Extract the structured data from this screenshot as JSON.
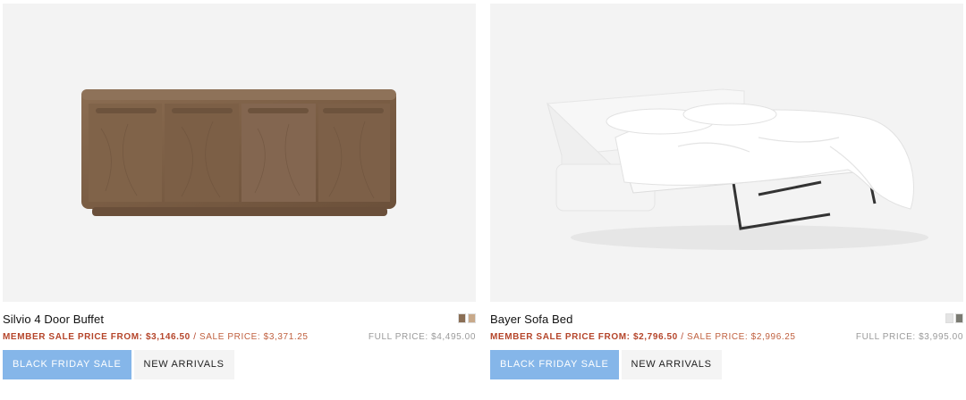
{
  "products": [
    {
      "name": "Silvio 4 Door Buffet",
      "member_price": "MEMBER SALE PRICE FROM: $3,146.50",
      "separator": "/",
      "sale_price": "SALE PRICE: $3,371.25",
      "full_price": "FULL PRICE: $4,495.00",
      "swatches": [
        "#8a6e55",
        "#c8a98a"
      ],
      "tags": [
        "BLACK FRIDAY SALE",
        "NEW ARRIVALS"
      ]
    },
    {
      "name": "Bayer Sofa Bed",
      "member_price": "MEMBER SALE PRICE FROM: $2,796.50",
      "separator": "/",
      "sale_price": "SALE PRICE: $2,996.25",
      "full_price": "FULL PRICE: $3,995.00",
      "swatches": [
        "#e4e4e4",
        "#7a7a72"
      ],
      "tags": [
        "BLACK FRIDAY SALE",
        "NEW ARRIVALS"
      ]
    }
  ]
}
